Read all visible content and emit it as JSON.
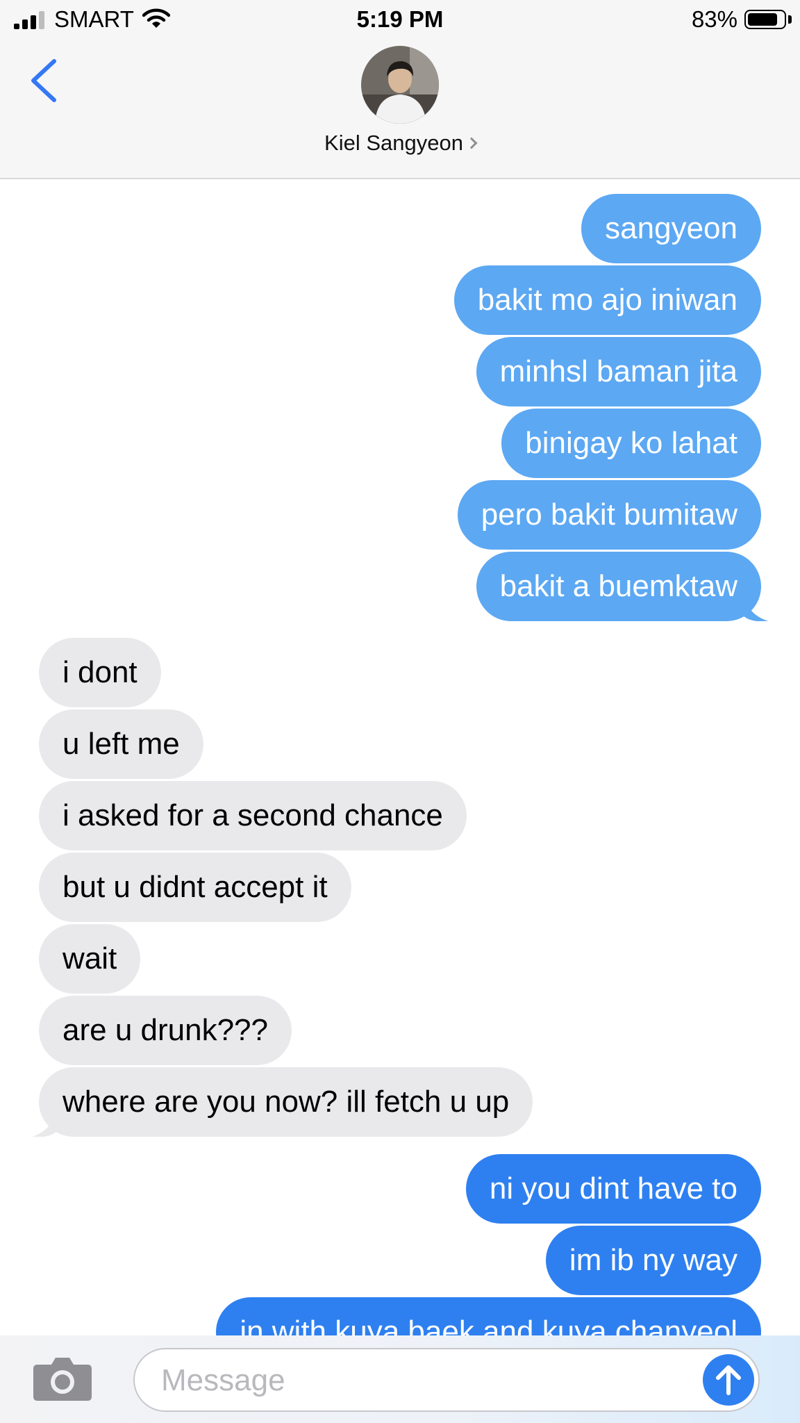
{
  "status_bar": {
    "carrier": "SMART",
    "time": "5:19 PM",
    "battery_percent": "83%",
    "battery_level": 0.83,
    "signal_bars": 3
  },
  "header": {
    "contact_name": "Kiel Sangyeon"
  },
  "messages": [
    {
      "direction": "outgoing",
      "text": "sangyeon"
    },
    {
      "direction": "outgoing",
      "text": "bakit mo ajo iniwan"
    },
    {
      "direction": "outgoing",
      "text": "minhsl baman jita"
    },
    {
      "direction": "outgoing",
      "text": "binigay ko lahat"
    },
    {
      "direction": "outgoing",
      "text": "pero bakit bumitaw"
    },
    {
      "direction": "outgoing",
      "text": "bakit a buemktaw"
    },
    {
      "direction": "incoming",
      "text": "i dont"
    },
    {
      "direction": "incoming",
      "text": "u left me"
    },
    {
      "direction": "incoming",
      "text": "i asked for a second chance"
    },
    {
      "direction": "incoming",
      "text": "but u didnt accept it"
    },
    {
      "direction": "incoming",
      "text": "wait"
    },
    {
      "direction": "incoming",
      "text": "are u drunk???"
    },
    {
      "direction": "incoming",
      "text": "where are you now? ill fetch u up"
    },
    {
      "direction": "outgoing",
      "text": "ni you dint have to"
    },
    {
      "direction": "outgoing",
      "text": "im ib ny way"
    },
    {
      "direction": "outgoing",
      "text": "in with kuya baek and kuya chanyeol"
    }
  ],
  "composer": {
    "placeholder": "Message",
    "value": ""
  },
  "colors": {
    "outgoing_light": "#5ca8f3",
    "outgoing_dark": "#2e80f0",
    "incoming": "#e9e9eb",
    "accent": "#2e80f0"
  },
  "icons": {
    "back": "chevron-left-icon",
    "camera": "camera-icon",
    "send": "arrow-up-icon",
    "wifi": "wifi-icon",
    "battery": "battery-icon",
    "signal": "signal-icon"
  }
}
